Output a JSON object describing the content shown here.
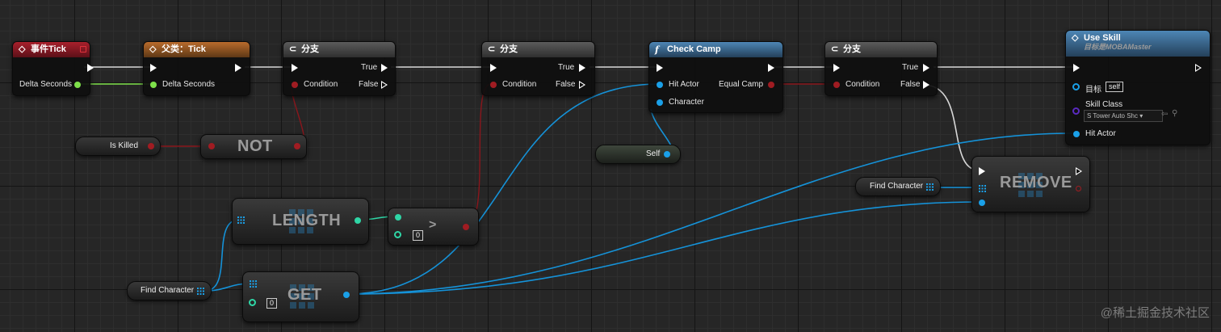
{
  "nodes": {
    "event_tick": {
      "title": "事件Tick",
      "pin_delta": "Delta Seconds"
    },
    "parent_tick": {
      "title": "父类：Tick",
      "pin_delta": "Delta Seconds"
    },
    "branch1": {
      "title": "分支",
      "condition": "Condition",
      "true": "True",
      "false": "False"
    },
    "branch2": {
      "title": "分支",
      "condition": "Condition",
      "true": "True",
      "false": "False"
    },
    "check_camp": {
      "title": "Check Camp",
      "hit_actor": "Hit Actor",
      "character": "Character",
      "equal_camp": "Equal Camp"
    },
    "branch3": {
      "title": "分支",
      "condition": "Condition",
      "true": "True",
      "false": "False"
    },
    "use_skill": {
      "title": "Use Skill",
      "subtitle": "目标是MOBAMaster",
      "target": "目标",
      "target_value": "self",
      "skill_class": "Skill Class",
      "skill_class_value": "S Tower Auto Shc",
      "hit_actor": "Hit Actor"
    },
    "is_killed": {
      "label": "Is Killed"
    },
    "not_node": {
      "label": "NOT"
    },
    "self_node": {
      "label": "Self"
    },
    "length_node": {
      "label": "LENGTH"
    },
    "greater_node": {
      "label": ">",
      "value": "0"
    },
    "get_node": {
      "label": "GET",
      "value": "0"
    },
    "remove_node": {
      "label": "REMOVE"
    },
    "find_character_1": {
      "label": "Find Character"
    },
    "find_character_2": {
      "label": "Find Character"
    }
  },
  "watermark": "@稀土掘金技术社区",
  "colors": {
    "exec": "#ffffff",
    "bool": "#a01c22",
    "float": "#7ee04a",
    "object": "#1aa0e8",
    "int": "#2fd6a6"
  }
}
